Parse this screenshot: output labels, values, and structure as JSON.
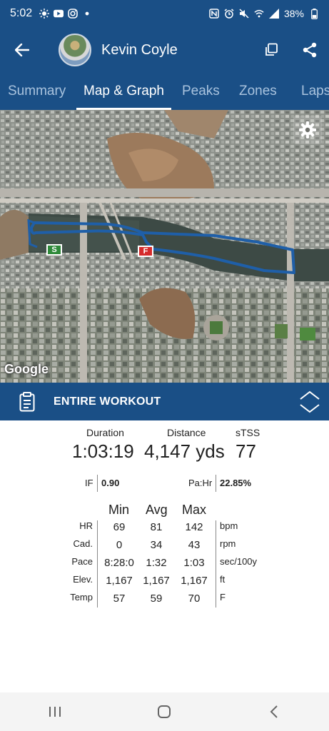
{
  "status_bar": {
    "time": "5:02",
    "battery": "38%"
  },
  "header": {
    "user_name": "Kevin Coyle"
  },
  "tabs": [
    {
      "label": "Summary"
    },
    {
      "label": "Map & Graph"
    },
    {
      "label": "Peaks"
    },
    {
      "label": "Zones"
    },
    {
      "label": "Laps"
    }
  ],
  "active_tab": "Map & Graph",
  "map": {
    "attribution": "Google",
    "start_marker": "S",
    "finish_marker": "F",
    "route_color": "#1f5fa8"
  },
  "section": {
    "title": "ENTIRE WORKOUT"
  },
  "summary": {
    "duration_label": "Duration",
    "duration_value": "1:03:19",
    "distance_label": "Distance",
    "distance_value": "4,147 yds",
    "stss_label": "sTSS",
    "stss_value": "77",
    "if_label": "IF",
    "if_value": "0.90",
    "pahr_label": "Pa:Hr",
    "pahr_value": "22.85%"
  },
  "stats_table": {
    "headers": [
      "Min",
      "Avg",
      "Max"
    ],
    "rows": [
      {
        "label": "HR",
        "min": "69",
        "avg": "81",
        "max": "142",
        "unit": "bpm"
      },
      {
        "label": "Cad.",
        "min": "0",
        "avg": "34",
        "max": "43",
        "unit": "rpm"
      },
      {
        "label": "Pace",
        "min": "8:28:0",
        "avg": "1:32",
        "max": "1:03",
        "unit": "sec/100y"
      },
      {
        "label": "Elev.",
        "min": "1,167",
        "avg": "1,167",
        "max": "1,167",
        "unit": "ft"
      },
      {
        "label": "Temp",
        "min": "57",
        "avg": "59",
        "max": "70",
        "unit": "F"
      }
    ]
  },
  "colors": {
    "primary": "#1a4f86",
    "tab_inactive": "#a9c3de"
  }
}
